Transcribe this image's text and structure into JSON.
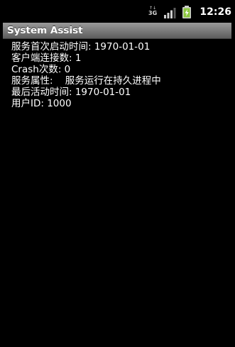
{
  "status_bar": {
    "network_type": "3G",
    "network_arrows": "↑↓",
    "signal_icon": "signal-bars-icon",
    "battery_icon": "battery-charging-icon",
    "battery_color": "#8cc63f",
    "time": "12:26"
  },
  "window": {
    "title": "System Assist",
    "title_bar_color": "#7a7a7a"
  },
  "info_lines": [
    "服务首次启动时间: 1970-01-01",
    "客户端连接数: 1",
    "Crash次数: 0",
    "服务属性:    服务运行在持久进程中",
    "最后活动时间: 1970-01-01",
    "用户ID: 1000"
  ]
}
